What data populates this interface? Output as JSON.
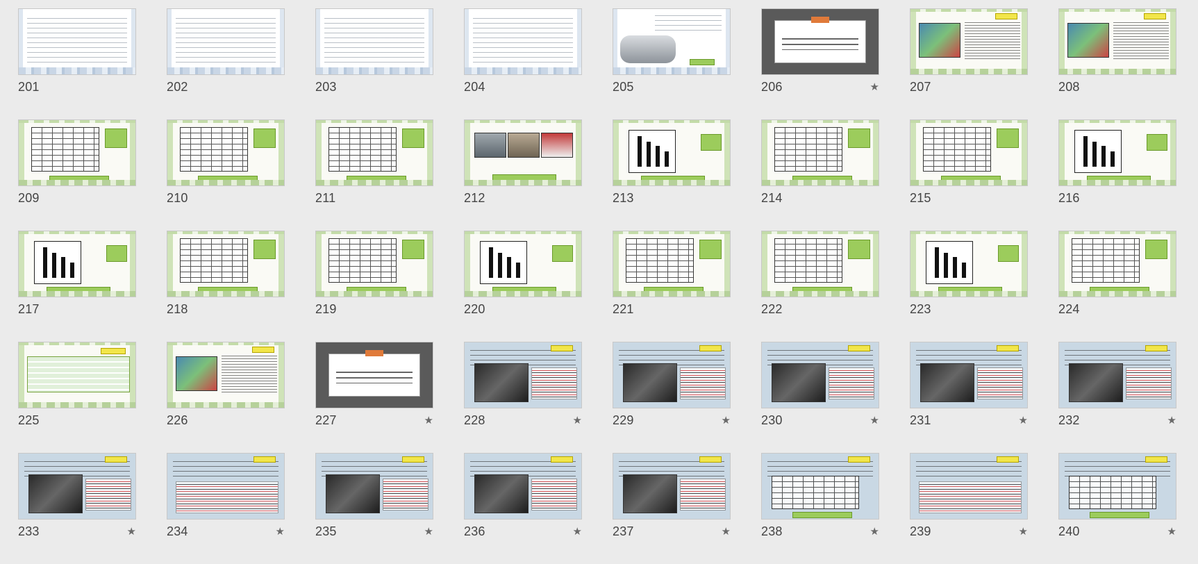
{
  "view": "slide-sorter",
  "colors": {
    "background": "#ebebeb",
    "star": "#6a6a6a",
    "number": "#444444"
  },
  "slides": [
    {
      "number": "201",
      "starred": false,
      "kind": "text"
    },
    {
      "number": "202",
      "starred": false,
      "kind": "text"
    },
    {
      "number": "203",
      "starred": false,
      "kind": "text"
    },
    {
      "number": "204",
      "starred": false,
      "kind": "text"
    },
    {
      "number": "205",
      "starred": false,
      "kind": "machine"
    },
    {
      "number": "206",
      "starred": true,
      "kind": "section"
    },
    {
      "number": "207",
      "starred": false,
      "kind": "green-photo"
    },
    {
      "number": "208",
      "starred": false,
      "kind": "green-photo"
    },
    {
      "number": "209",
      "starred": false,
      "kind": "green-table"
    },
    {
      "number": "210",
      "starred": false,
      "kind": "green-table"
    },
    {
      "number": "211",
      "starred": false,
      "kind": "green-table"
    },
    {
      "number": "212",
      "starred": false,
      "kind": "green-photos"
    },
    {
      "number": "213",
      "starred": false,
      "kind": "green-chart"
    },
    {
      "number": "214",
      "starred": false,
      "kind": "green-table"
    },
    {
      "number": "215",
      "starred": false,
      "kind": "green-table"
    },
    {
      "number": "216",
      "starred": false,
      "kind": "green-chart"
    },
    {
      "number": "217",
      "starred": false,
      "kind": "green-chart"
    },
    {
      "number": "218",
      "starred": false,
      "kind": "green-table"
    },
    {
      "number": "219",
      "starred": false,
      "kind": "green-table"
    },
    {
      "number": "220",
      "starred": false,
      "kind": "green-chart"
    },
    {
      "number": "221",
      "starred": false,
      "kind": "green-table"
    },
    {
      "number": "222",
      "starred": false,
      "kind": "green-table"
    },
    {
      "number": "223",
      "starred": false,
      "kind": "green-chart"
    },
    {
      "number": "224",
      "starred": false,
      "kind": "green-table"
    },
    {
      "number": "225",
      "starred": false,
      "kind": "green-text"
    },
    {
      "number": "226",
      "starred": false,
      "kind": "green-photo"
    },
    {
      "number": "227",
      "starred": true,
      "kind": "section"
    },
    {
      "number": "228",
      "starred": true,
      "kind": "blue-photo"
    },
    {
      "number": "229",
      "starred": true,
      "kind": "blue-photo"
    },
    {
      "number": "230",
      "starred": true,
      "kind": "blue-photo"
    },
    {
      "number": "231",
      "starred": true,
      "kind": "blue-photo"
    },
    {
      "number": "232",
      "starred": true,
      "kind": "blue-photo"
    },
    {
      "number": "233",
      "starred": true,
      "kind": "blue-photo"
    },
    {
      "number": "234",
      "starred": true,
      "kind": "blue-text"
    },
    {
      "number": "235",
      "starred": true,
      "kind": "blue-photo"
    },
    {
      "number": "236",
      "starred": true,
      "kind": "blue-photo"
    },
    {
      "number": "237",
      "starred": true,
      "kind": "blue-photo"
    },
    {
      "number": "238",
      "starred": true,
      "kind": "blue-table"
    },
    {
      "number": "239",
      "starred": true,
      "kind": "blue-text"
    },
    {
      "number": "240",
      "starred": true,
      "kind": "blue-table"
    }
  ]
}
